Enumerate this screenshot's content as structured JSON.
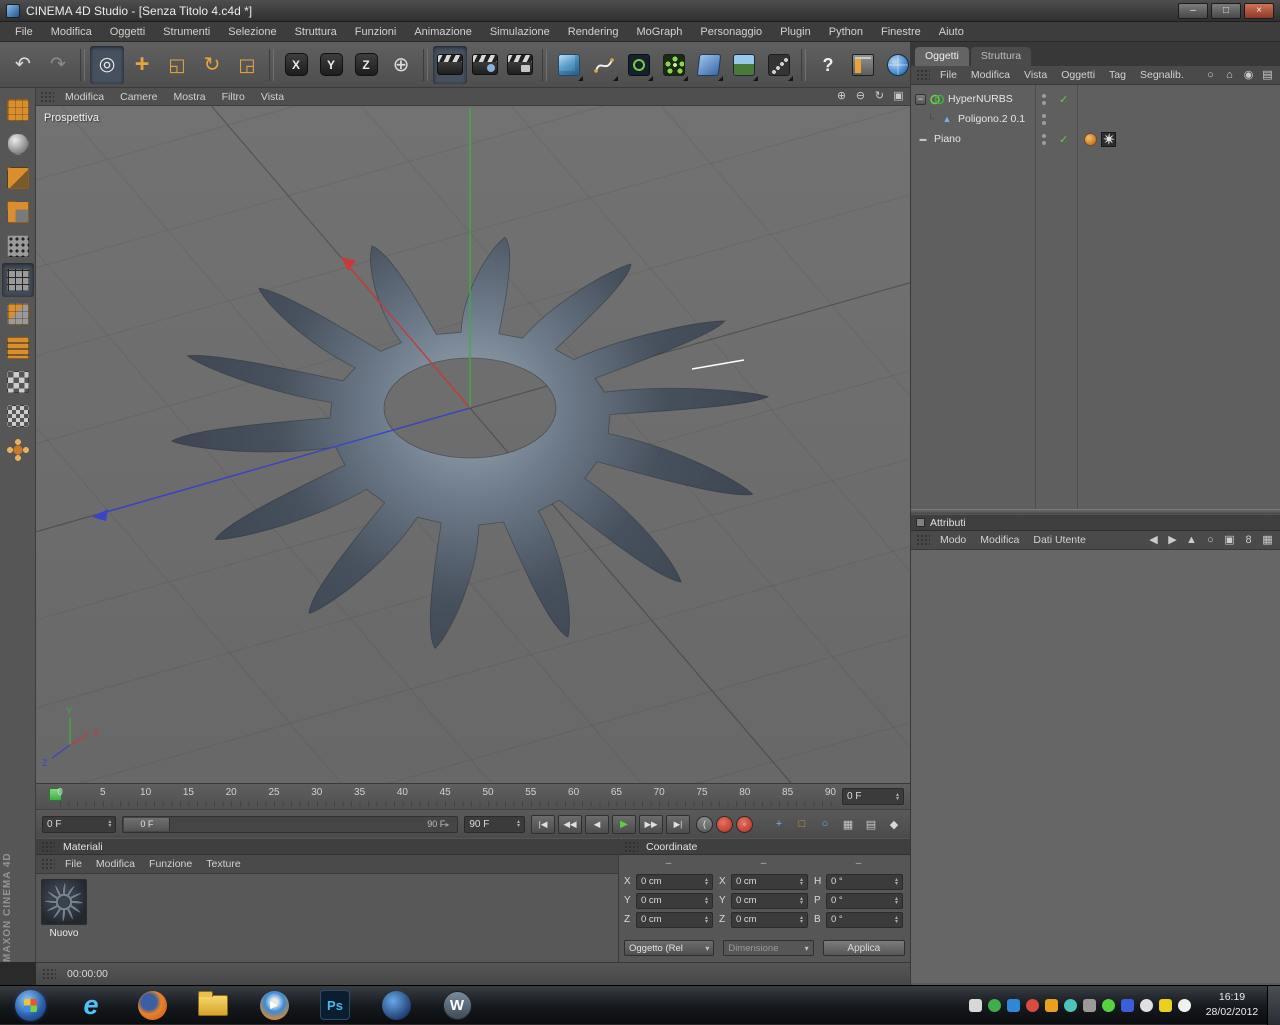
{
  "window": {
    "title": "CINEMA 4D Studio - [Senza Titolo 4.c4d *]",
    "minimize": "–",
    "maximize": "□",
    "close": "×"
  },
  "menubar": {
    "items": [
      "File",
      "Modifica",
      "Oggetti",
      "Strumenti",
      "Selezione",
      "Struttura",
      "Funzioni",
      "Animazione",
      "Simulazione",
      "Rendering",
      "MoGraph",
      "Personaggio",
      "Plugin",
      "Python",
      "Finestre",
      "Aiuto"
    ]
  },
  "toolbar": {
    "buttons": [
      {
        "name": "undo",
        "style": "undo",
        "glyph": "↶"
      },
      {
        "name": "redo",
        "style": "redo",
        "glyph": "↷"
      },
      {
        "name": "sep"
      },
      {
        "name": "live-selection",
        "style": "sel",
        "glyph": "◎",
        "active": true
      },
      {
        "name": "move-tool",
        "style": "move",
        "glyph": "+"
      },
      {
        "name": "scale-tool",
        "style": "scale",
        "glyph": "◱"
      },
      {
        "name": "rotate-tool",
        "style": "rotate",
        "glyph": "↻"
      },
      {
        "name": "last-used-tool",
        "style": "last",
        "glyph": "◲"
      },
      {
        "name": "sep"
      },
      {
        "name": "lock-x-axis",
        "style": "axis",
        "glyph": "X"
      },
      {
        "name": "lock-y-axis",
        "style": "axis",
        "glyph": "Y"
      },
      {
        "name": "lock-z-axis",
        "style": "axis",
        "glyph": "Z"
      },
      {
        "name": "coordinate-system",
        "style": "coord",
        "glyph": "⊕"
      },
      {
        "name": "sep"
      },
      {
        "name": "render-view",
        "style": "clapper",
        "active": true
      },
      {
        "name": "render-picture-viewer",
        "style": "clapper2"
      },
      {
        "name": "render-settings",
        "style": "clapper3"
      },
      {
        "name": "sep"
      },
      {
        "name": "add-cube",
        "style": "cube",
        "dropdown": true
      },
      {
        "name": "add-spline",
        "style": "spline",
        "dropdown": true
      },
      {
        "name": "add-hypernurbs",
        "style": "hypernurbs",
        "dropdown": true
      },
      {
        "name": "add-array",
        "style": "array",
        "dropdown": true
      },
      {
        "name": "add-deformer",
        "style": "deformer",
        "dropdown": true
      },
      {
        "name": "add-environment",
        "style": "environment",
        "dropdown": true
      },
      {
        "name": "add-particles",
        "style": "particles",
        "dropdown": true
      },
      {
        "name": "sep"
      },
      {
        "name": "help",
        "style": "help",
        "glyph": "?"
      },
      {
        "name": "interface-layout",
        "style": "layout"
      },
      {
        "name": "online-updater",
        "style": "globe"
      }
    ]
  },
  "tool_palette": {
    "items": [
      {
        "name": "make-editable",
        "style": "i-convert"
      },
      {
        "name": "model-mode",
        "style": "i-model"
      },
      {
        "name": "object-axis-mode",
        "style": "i-axis"
      },
      {
        "name": "texture-mode",
        "style": "i-texture"
      },
      {
        "name": "points-mode",
        "style": "i-points"
      },
      {
        "name": "edges-mode",
        "style": "i-edges",
        "active": true
      },
      {
        "name": "polygons-mode",
        "style": "i-polys"
      },
      {
        "name": "animation-mode",
        "style": "i-anim"
      },
      {
        "name": "workplane-mode",
        "style": "i-plane"
      },
      {
        "name": "snap-settings",
        "style": "i-snap"
      },
      {
        "name": "selection-filter",
        "style": "i-lock"
      }
    ]
  },
  "viewport": {
    "label": "Prospettiva",
    "menu": [
      "Modifica",
      "Camere",
      "Mostra",
      "Filtro",
      "Vista"
    ],
    "nav": [
      {
        "name": "camera-pan",
        "glyph": "⊕"
      },
      {
        "name": "camera-zoom",
        "glyph": "⊖"
      },
      {
        "name": "camera-rotate",
        "glyph": "↻"
      },
      {
        "name": "viewport-toggle",
        "glyph": "▣"
      }
    ],
    "axis_labels": {
      "x": "X",
      "y": "Y",
      "z": "Z"
    }
  },
  "object_manager": {
    "tabs": [
      {
        "label": "Oggetti",
        "active": true
      },
      {
        "label": "Struttura",
        "active": false
      }
    ],
    "menu": [
      "File",
      "Modifica",
      "Vista",
      "Oggetti",
      "Tag",
      "Segnalib."
    ],
    "icons": [
      {
        "name": "search",
        "glyph": "○"
      },
      {
        "name": "home",
        "glyph": "⌂"
      },
      {
        "name": "eye",
        "glyph": "◉"
      },
      {
        "name": "panel",
        "glyph": "▤"
      }
    ],
    "tree": [
      {
        "name": "HyperNURBS",
        "level": 0,
        "icon": "hypernurbs",
        "expander": true,
        "check": true
      },
      {
        "name": "Poligono.2 0.1",
        "level": 1,
        "icon": "polygon",
        "check": false
      },
      {
        "name": "Piano",
        "level": 0,
        "icon": "plane",
        "check": true,
        "tags": [
          "phong",
          "texture"
        ]
      }
    ]
  },
  "attributes": {
    "title": "Attributi",
    "menu": [
      "Modo",
      "Modifica",
      "Dati Utente"
    ],
    "icons": [
      {
        "name": "back",
        "glyph": "◀"
      },
      {
        "name": "forward",
        "glyph": "▶"
      },
      {
        "name": "up",
        "glyph": "▲"
      },
      {
        "name": "search",
        "glyph": "○"
      },
      {
        "name": "lock",
        "glyph": "▣"
      },
      {
        "name": "track",
        "glyph": "8"
      },
      {
        "name": "grid",
        "glyph": "▦"
      }
    ]
  },
  "timeline": {
    "ticks": [
      "0",
      "5",
      "10",
      "15",
      "20",
      "25",
      "30",
      "35",
      "40",
      "45",
      "50",
      "55",
      "60",
      "65",
      "70",
      "75",
      "80",
      "85",
      "90"
    ],
    "current_frame": "0 F",
    "field_start": "0 F",
    "slider_start": "0 F",
    "slider_end": "90 F",
    "field_end": "90 F"
  },
  "transport": {
    "buttons": [
      {
        "name": "goto-start",
        "glyph": "|◀"
      },
      {
        "name": "previous-key",
        "glyph": "◀◀"
      },
      {
        "name": "previous-frame",
        "glyph": "◀"
      },
      {
        "name": "play-forward",
        "glyph": "▶",
        "accent": true
      },
      {
        "name": "next-frame",
        "glyph": "▶▶"
      },
      {
        "name": "goto-end",
        "glyph": "▶|"
      }
    ],
    "record": [
      {
        "name": "record-keyframe",
        "style": "rec-gray",
        "glyph": "("
      },
      {
        "name": "autokeying",
        "style": "rec-red",
        "glyph": ""
      },
      {
        "name": "record-options",
        "style": "rec-red2",
        "glyph": "◦"
      }
    ],
    "keys": [
      {
        "name": "record-position",
        "glyph": "+",
        "color": "#7ab0e0"
      },
      {
        "name": "record-scale",
        "glyph": "□",
        "color": "#e09a3a"
      },
      {
        "name": "record-rotation",
        "glyph": "○",
        "color": "#7ab0e0"
      },
      {
        "name": "record-parameters",
        "glyph": "▦",
        "color": "#c8c8c8"
      },
      {
        "name": "record-pla",
        "glyph": "▤",
        "color": "#c8c8c8"
      },
      {
        "name": "keyframe-selection",
        "glyph": "◆",
        "color": "#d8d8d8"
      }
    ]
  },
  "materials": {
    "title": "Materiali",
    "menu": [
      "File",
      "Modifica",
      "Funzione",
      "Texture"
    ],
    "items": [
      {
        "label": "Nuovo"
      }
    ]
  },
  "coordinates": {
    "title": "Coordinate",
    "groups": [
      {
        "header": "–",
        "rows": [
          {
            "label": "X",
            "value": "0 cm"
          },
          {
            "label": "Y",
            "value": "0 cm"
          },
          {
            "label": "Z",
            "value": "0 cm"
          }
        ]
      },
      {
        "header": "–",
        "rows": [
          {
            "label": "X",
            "value": "0 cm"
          },
          {
            "label": "Y",
            "value": "0 cm"
          },
          {
            "label": "Z",
            "value": "0 cm"
          }
        ]
      },
      {
        "header": "–",
        "rows": [
          {
            "label": "H",
            "value": "0 °"
          },
          {
            "label": "P",
            "value": "0 °"
          },
          {
            "label": "B",
            "value": "0 °"
          }
        ]
      }
    ],
    "mode_select": "Oggetto (Rel",
    "size_select": "Dimensione",
    "apply_label": "Applica"
  },
  "statusbar": {
    "time": "00:00:00"
  },
  "branding": {
    "vertical": "MAXON  CINEMA 4D"
  },
  "taskbar": {
    "apps": [
      {
        "name": "start",
        "style": "start"
      },
      {
        "name": "internet-explorer",
        "style": "ie",
        "glyph": "e"
      },
      {
        "name": "firefox",
        "style": "firefox"
      },
      {
        "name": "file-explorer",
        "style": "folder"
      },
      {
        "name": "media-player",
        "style": "wmp",
        "glyph": "▶"
      },
      {
        "name": "photoshop",
        "style": "ps",
        "glyph": "Ps"
      },
      {
        "name": "utorrent",
        "style": "blueapp"
      },
      {
        "name": "wordpress",
        "style": "wapp",
        "glyph": "W"
      }
    ],
    "tray": [
      {
        "name": "tray-icon-1",
        "color": "#d8d8d8",
        "shape": "square"
      },
      {
        "name": "tray-icon-2",
        "color": "#3fae49",
        "shape": "round"
      },
      {
        "name": "tray-icon-3",
        "color": "#2d89d8",
        "shape": "square"
      },
      {
        "name": "tray-icon-4",
        "color": "#d84b3f",
        "shape": "round"
      },
      {
        "name": "tray-icon-5",
        "color": "#e8a020",
        "shape": "square"
      },
      {
        "name": "tray-icon-6",
        "color": "#4fc3b7",
        "shape": "round"
      },
      {
        "name": "tray-icon-7",
        "color": "#9a9a9a",
        "shape": "square"
      },
      {
        "name": "tray-icon-8",
        "color": "#58d23f",
        "shape": "round"
      },
      {
        "name": "tray-icon-9",
        "color": "#3a5fd8",
        "shape": "square"
      },
      {
        "name": "tray-icon-10",
        "color": "#e0e0e0",
        "shape": "round"
      },
      {
        "name": "tray-icon-11",
        "color": "#e8d020",
        "shape": "square"
      },
      {
        "name": "tray-icon-12",
        "color": "#f0f0f0",
        "shape": "round"
      }
    ],
    "clock": {
      "time": "16:19",
      "date": "28/02/2012"
    }
  }
}
